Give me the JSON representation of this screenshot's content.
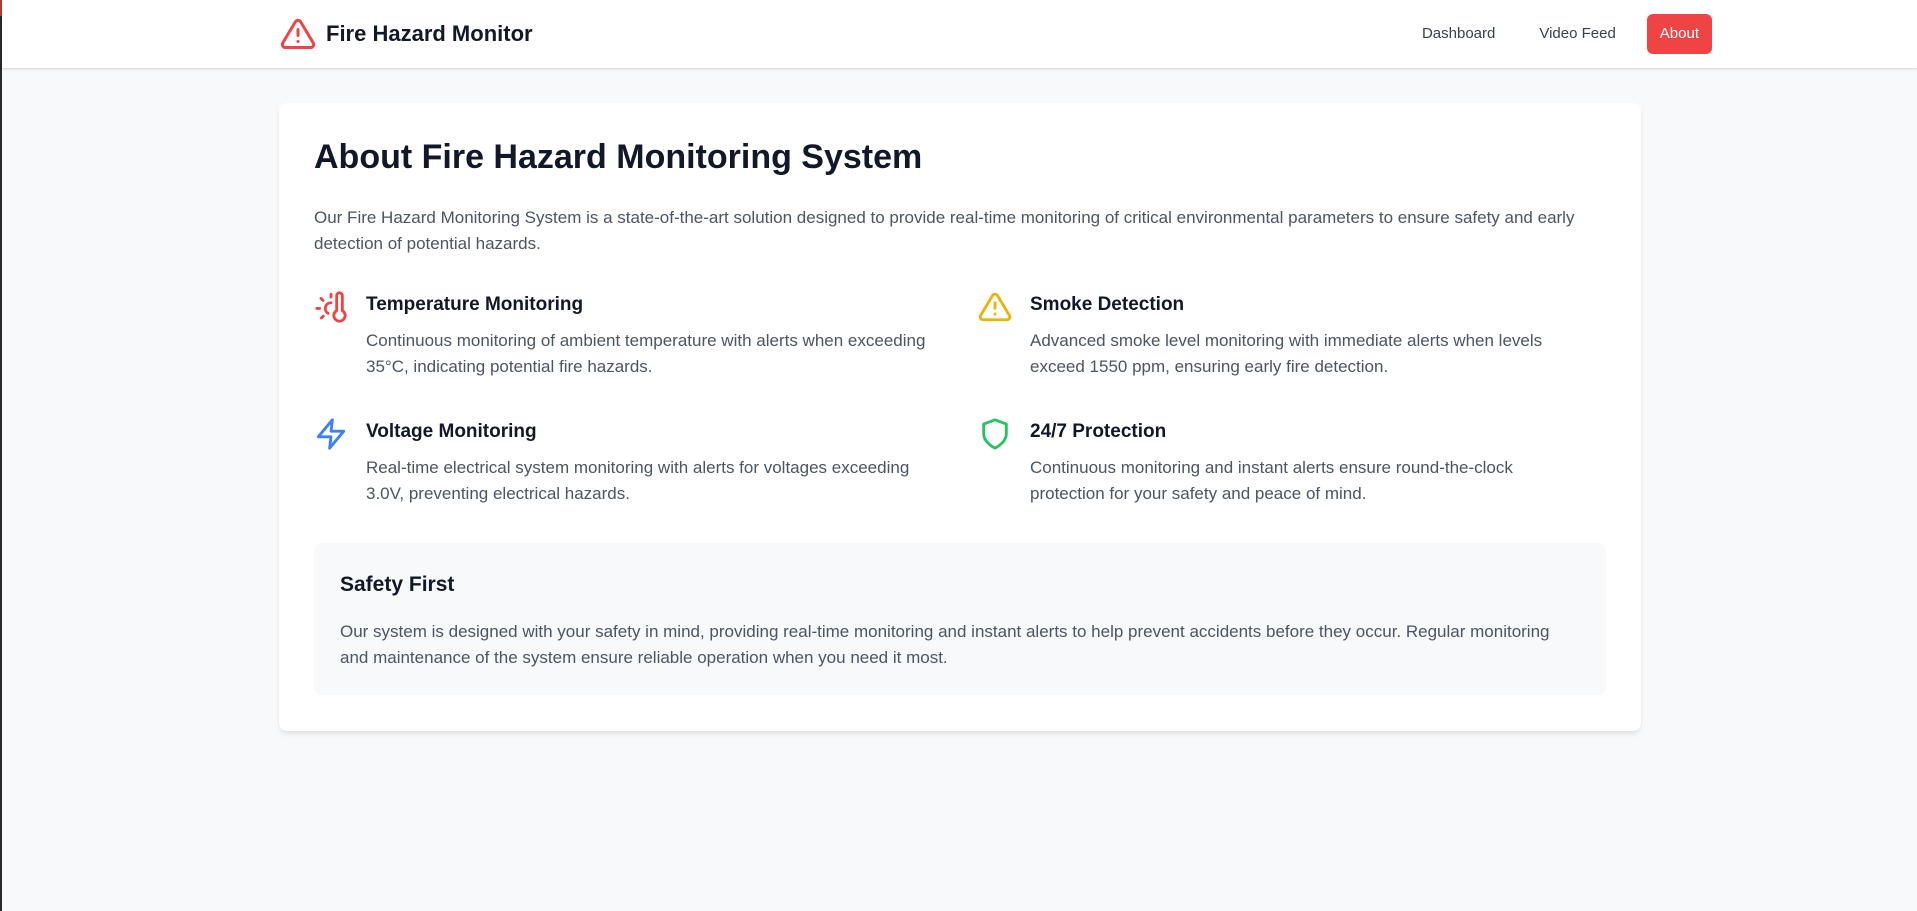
{
  "app": {
    "title": "Fire Hazard Monitor",
    "logo_icon": "alert-triangle-icon",
    "accent_color": "#ef4444"
  },
  "nav": {
    "items": [
      {
        "label": "Dashboard",
        "active": false
      },
      {
        "label": "Video Feed",
        "active": false
      },
      {
        "label": "About",
        "active": true
      }
    ]
  },
  "about": {
    "title": "About Fire Hazard Monitoring System",
    "intro": "Our Fire Hazard Monitoring System is a state-of-the-art solution designed to provide real-time monitoring of critical environmental parameters to ensure safety and early detection of potential hazards.",
    "features": [
      {
        "title": "Temperature Monitoring",
        "description": "Continuous monitoring of ambient temperature with alerts when exceeding 35°C, indicating potential fire hazards.",
        "icon": "thermometer-sun-icon",
        "color": "#ef4444"
      },
      {
        "title": "Smoke Detection",
        "description": "Advanced smoke level monitoring with immediate alerts when levels exceed 1550 ppm, ensuring early fire detection.",
        "icon": "alert-triangle-icon",
        "color": "#eab308"
      },
      {
        "title": "Voltage Monitoring",
        "description": "Real-time electrical system monitoring with alerts for voltages exceeding 3.0V, preventing electrical hazards.",
        "icon": "zap-icon",
        "color": "#3b82f6"
      },
      {
        "title": "24/7 Protection",
        "description": "Continuous monitoring and instant alerts ensure round-the-clock protection for your safety and peace of mind.",
        "icon": "shield-icon",
        "color": "#22c55e"
      }
    ],
    "safety": {
      "title": "Safety First",
      "text": "Our system is designed with your safety in mind, providing real-time monitoring and instant alerts to help prevent accidents before they occur. Regular monitoring and maintenance of the system ensure reliable operation when you need it most."
    }
  }
}
